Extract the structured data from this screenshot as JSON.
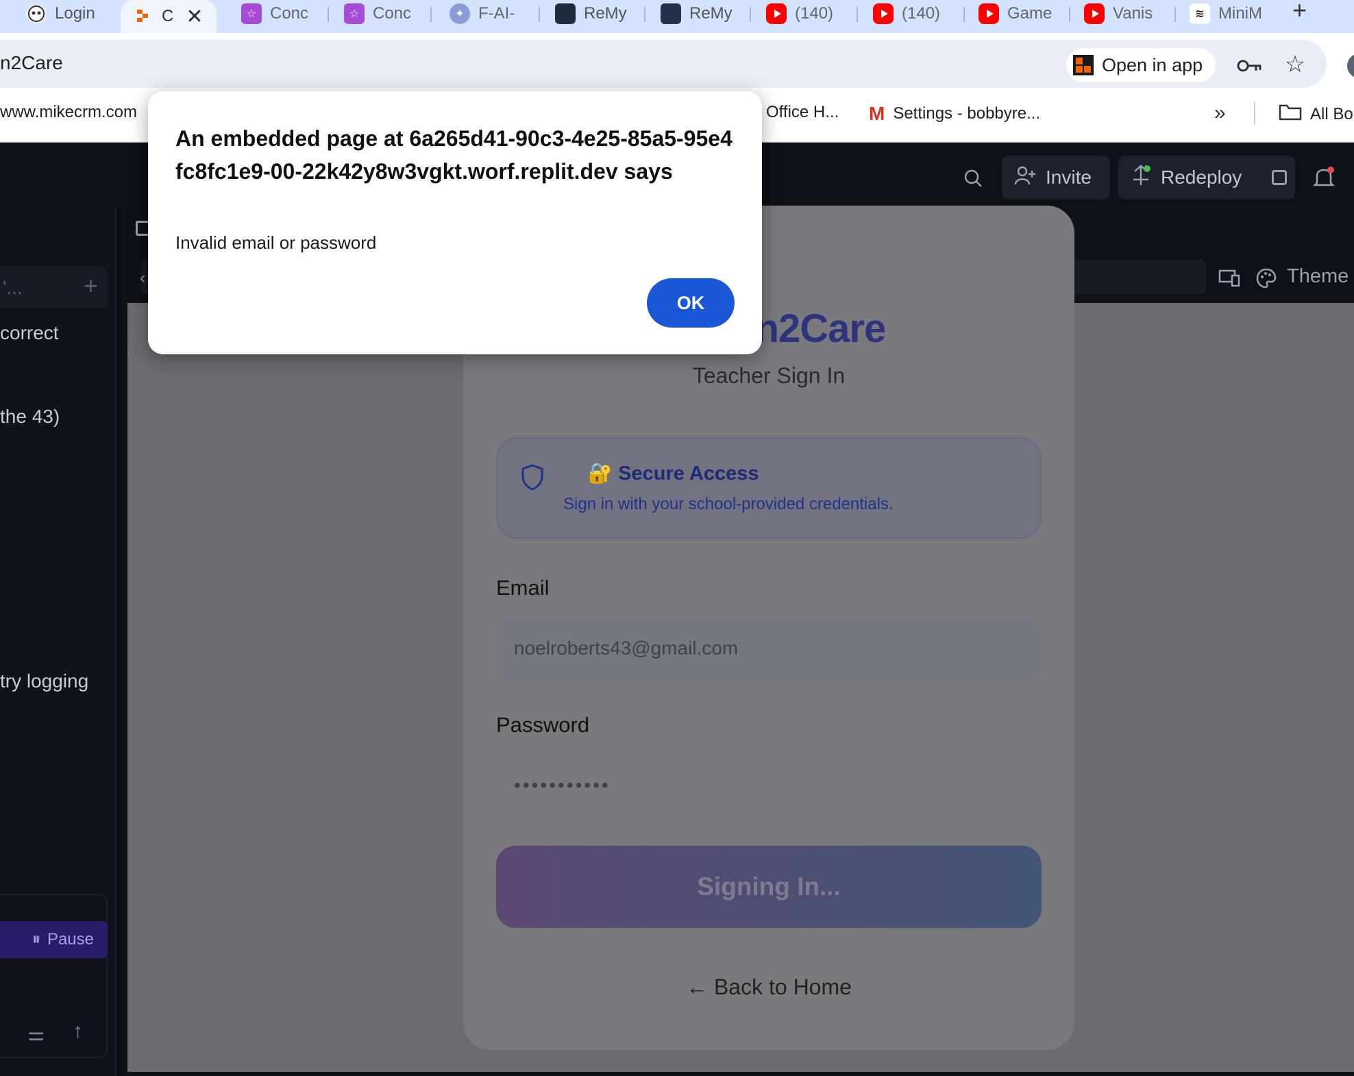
{
  "browser": {
    "tabs": [
      {
        "label": "Login",
        "icon": "robot-icon"
      },
      {
        "label": "C",
        "icon": "replit-icon",
        "active": true
      },
      {
        "label": "Conc",
        "icon": "star-app-icon"
      },
      {
        "label": "Conc",
        "icon": "star-app-icon"
      },
      {
        "label": "F-AI-",
        "icon": "compass-icon"
      },
      {
        "label": "ReMy",
        "icon": "remy-icon"
      },
      {
        "label": "ReMy",
        "icon": "remy-spark-icon"
      },
      {
        "label": "(140)",
        "icon": "youtube-icon"
      },
      {
        "label": "(140)",
        "icon": "youtube-icon"
      },
      {
        "label": "Game",
        "icon": "youtube-icon"
      },
      {
        "label": "Vanis",
        "icon": "youtube-icon"
      },
      {
        "label": "MiniM",
        "icon": "waveform-icon"
      }
    ],
    "address": "n2Care",
    "open_in_app": "Open in app",
    "bookmarks": [
      "www.mikecrm.com",
      "Office H...",
      "Settings - bobbyre...",
      "All Bo"
    ],
    "colors": {
      "tabstrip": "#d3e3fd",
      "youtube": "#ff0000"
    }
  },
  "replit": {
    "invite": "Invite",
    "redeploy": "Redeploy",
    "theme": "Theme",
    "pause": "Pause",
    "left_panel_lines": [
      "correct",
      "the 43)",
      "try logging"
    ]
  },
  "preview": {
    "brand": "rn2Care",
    "subtitle": "Teacher Sign In",
    "secure_title": "🔐 Secure Access",
    "secure_text": "Sign in with your school-provided credentials.",
    "email_label": "Email",
    "email_value": "noelroberts43@gmail.com",
    "password_label": "Password",
    "password_mask": "•••••••••••",
    "signin_label": "Signing In...",
    "back_home": "← Back to Home",
    "colors": {
      "brand": "#2d347c",
      "signin_gradient_start": "#5b4873",
      "signin_gradient_end": "#445577"
    }
  },
  "dialog": {
    "title": "An embedded page at 6a265d41-90c3-4e25-85a5-95e4fc8fc1e9-00-22k42y8w3vgkt.worf.replit.dev says",
    "message": "Invalid email or password",
    "ok": "OK",
    "colors": {
      "ok_button": "#1a57d6"
    }
  }
}
